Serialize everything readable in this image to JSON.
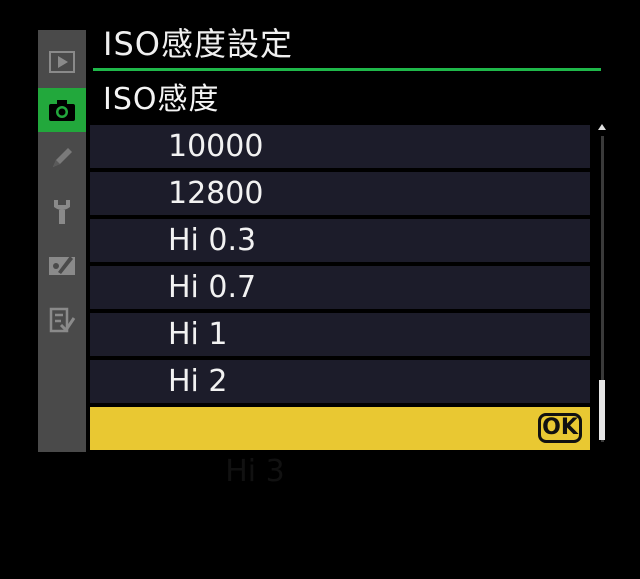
{
  "header": {
    "title": "ISO感度設定",
    "subtitle": "ISO感度"
  },
  "tabs": [
    {
      "name": "playback-icon",
      "active": false
    },
    {
      "name": "camera-icon",
      "active": true
    },
    {
      "name": "pencil-icon",
      "active": false
    },
    {
      "name": "wrench-icon",
      "active": false
    },
    {
      "name": "retouch-icon",
      "active": false
    },
    {
      "name": "my-menu-icon",
      "active": false
    }
  ],
  "list": {
    "items": [
      {
        "label": "10000"
      },
      {
        "label": "12800"
      },
      {
        "label": "Hi 0.3"
      },
      {
        "label": "Hi 0.7"
      },
      {
        "label": "Hi 1"
      },
      {
        "label": "Hi 2"
      },
      {
        "label": "Hi 3",
        "selected": true
      }
    ],
    "ok_label": "OK"
  },
  "colors": {
    "accent_green": "#22a83c",
    "highlight_yellow": "#e9c832",
    "row_background": "#1c1c2a"
  }
}
